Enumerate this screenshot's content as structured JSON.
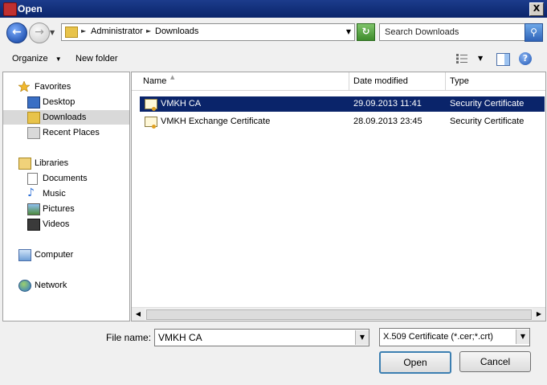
{
  "window": {
    "title": "Open",
    "close_label": "X"
  },
  "nav": {
    "breadcrumbs": [
      "Administrator",
      "Downloads"
    ],
    "search_placeholder": "Search Downloads"
  },
  "toolbar": {
    "organize": "Organize",
    "new_folder": "New folder",
    "help": "?"
  },
  "sidebar": {
    "groups": [
      {
        "label": "Favorites",
        "icon": "star-icon",
        "items": [
          {
            "label": "Desktop",
            "icon": "desktop-icon"
          },
          {
            "label": "Downloads",
            "icon": "downloads-folder-icon",
            "selected": true
          },
          {
            "label": "Recent Places",
            "icon": "recent-places-icon"
          }
        ]
      },
      {
        "label": "Libraries",
        "icon": "libraries-icon",
        "items": [
          {
            "label": "Documents",
            "icon": "documents-icon"
          },
          {
            "label": "Music",
            "icon": "music-icon"
          },
          {
            "label": "Pictures",
            "icon": "pictures-icon"
          },
          {
            "label": "Videos",
            "icon": "videos-icon"
          }
        ]
      },
      {
        "label": "Computer",
        "icon": "computer-icon",
        "items": []
      },
      {
        "label": "Network",
        "icon": "network-icon",
        "items": []
      }
    ]
  },
  "files": {
    "columns": [
      "Name",
      "Date modified",
      "Type"
    ],
    "rows": [
      {
        "name": "VMKH CA",
        "date": "29.09.2013 11:41",
        "type": "Security Certificate",
        "selected": true
      },
      {
        "name": "VMKH Exchange Certificate",
        "date": "28.09.2013 23:45",
        "type": "Security Certificate",
        "selected": false
      }
    ]
  },
  "bottom": {
    "file_name_label": "File name:",
    "file_name_value": "VMKH CA",
    "filter_value": "X.509 Certificate (*.cer;*.crt)",
    "open_label": "Open",
    "cancel_label": "Cancel"
  },
  "colors": {
    "selection": "#0a246a",
    "titlebar": "#0a246a"
  }
}
